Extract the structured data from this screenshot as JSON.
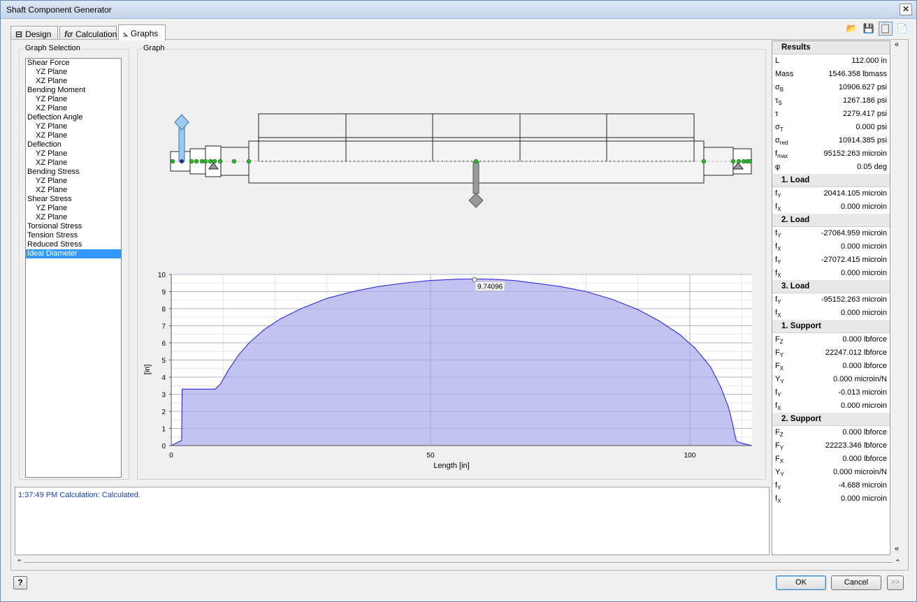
{
  "window": {
    "title": "Shaft Component Generator",
    "close_symbol": "✕"
  },
  "tabs": [
    {
      "label": "Design",
      "icon": "design-icon"
    },
    {
      "label": "Calculation",
      "icon": "calculation-icon"
    },
    {
      "label": "Graphs",
      "icon": "graph-icon"
    }
  ],
  "active_tab": "Graphs",
  "graph_selection": {
    "caption": "Graph Selection",
    "items": [
      {
        "label": "Shear Force",
        "level": 0
      },
      {
        "label": "YZ Plane",
        "level": 1
      },
      {
        "label": "XZ Plane",
        "level": 1
      },
      {
        "label": "Bending Moment",
        "level": 0
      },
      {
        "label": "YZ Plane",
        "level": 1
      },
      {
        "label": "XZ Plane",
        "level": 1
      },
      {
        "label": "Deflection Angle",
        "level": 0
      },
      {
        "label": "YZ Plane",
        "level": 1
      },
      {
        "label": "XZ Plane",
        "level": 1
      },
      {
        "label": "Deflection",
        "level": 0
      },
      {
        "label": "YZ Plane",
        "level": 1
      },
      {
        "label": "XZ Plane",
        "level": 1
      },
      {
        "label": "Bending Stress",
        "level": 0
      },
      {
        "label": "YZ Plane",
        "level": 1
      },
      {
        "label": "XZ Plane",
        "level": 1
      },
      {
        "label": "Shear Stress",
        "level": 0
      },
      {
        "label": "YZ Plane",
        "level": 1
      },
      {
        "label": "XZ Plane",
        "level": 1
      },
      {
        "label": "Torsional Stress",
        "level": 0
      },
      {
        "label": "Tension Stress",
        "level": 0
      },
      {
        "label": "Reduced Stress",
        "level": 0
      },
      {
        "label": "Ideal Diameter",
        "level": 0,
        "selected": true
      }
    ]
  },
  "graph": {
    "caption": "Graph",
    "marker_label": "9.74096"
  },
  "chart_data": {
    "type": "area",
    "xlabel": "Length [in]",
    "ylabel": "[in]",
    "xlim": [
      0,
      112
    ],
    "ylim": [
      0,
      10
    ],
    "x_ticks": [
      "0",
      "50",
      "100"
    ],
    "y_ticks": [
      "0",
      "1",
      "2",
      "3",
      "4",
      "5",
      "6",
      "7",
      "8",
      "9",
      "10"
    ],
    "grid": true,
    "fill_color": "#c2c3f0",
    "line_color": "#2a2ae0",
    "series": [
      {
        "x": [
          0,
          2,
          2.1,
          8.5,
          9.5,
          11,
          13,
          15,
          18,
          21,
          25,
          30,
          35,
          40,
          45,
          50,
          55,
          58.5,
          62,
          66,
          70,
          75,
          80,
          85,
          90,
          94,
          98,
          101,
          104,
          106,
          107.5,
          108.3,
          108.7,
          109,
          110.5,
          112
        ],
        "y": [
          0,
          0.3,
          3.3,
          3.3,
          3.6,
          4.4,
          5.3,
          6.0,
          6.8,
          7.4,
          8.0,
          8.6,
          9.0,
          9.3,
          9.5,
          9.65,
          9.72,
          9.74,
          9.72,
          9.65,
          9.5,
          9.3,
          9.0,
          8.55,
          7.95,
          7.3,
          6.5,
          5.7,
          4.6,
          3.4,
          2.2,
          1.2,
          0.6,
          0.25,
          0.1,
          0
        ]
      }
    ],
    "annotations": [
      {
        "x": 58.5,
        "y": 9.74,
        "text": "9.74096"
      }
    ]
  },
  "log": {
    "message": "1:37:49 PM Calculation: Calculated."
  },
  "results": {
    "header": "Results",
    "rows": [
      {
        "k": "L",
        "sub": "",
        "v": "112.000 in"
      },
      {
        "k": "Mass",
        "sub": "",
        "v": "1546.358 lbmass"
      },
      {
        "k": "σ",
        "sub": "B",
        "v": "10906.627 psi"
      },
      {
        "k": "τ",
        "sub": "S",
        "v": "1267.186 psi"
      },
      {
        "k": "τ",
        "sub": "",
        "v": "2279.417 psi"
      },
      {
        "k": "σ",
        "sub": "T",
        "v": "0.000 psi"
      },
      {
        "k": "σ",
        "sub": "red",
        "v": "10914.385 psi"
      },
      {
        "k": "f",
        "sub": "max",
        "v": "95152.263 microin"
      },
      {
        "k": "φ",
        "sub": "",
        "v": "0.05 deg"
      },
      {
        "section": "1. Load"
      },
      {
        "k": "f",
        "sub": "Y",
        "v": "20414.105 microin"
      },
      {
        "k": "f",
        "sub": "X",
        "v": "0.000 microin"
      },
      {
        "section": "2. Load"
      },
      {
        "k": "f",
        "sub": "Y",
        "v": "-27064.959 microin"
      },
      {
        "k": "f",
        "sub": "X",
        "v": "0.000 microin"
      },
      {
        "k": "f",
        "sub": "Y",
        "v": "-27072.415 microin"
      },
      {
        "k": "f",
        "sub": "X",
        "v": "0.000 microin"
      },
      {
        "section": "3. Load"
      },
      {
        "k": "f",
        "sub": "Y",
        "v": "-95152.263 microin"
      },
      {
        "k": "f",
        "sub": "X",
        "v": "0.000 microin"
      },
      {
        "section": "1. Support"
      },
      {
        "k": "F",
        "sub": "Z",
        "v": "0.000 lbforce"
      },
      {
        "k": "F",
        "sub": "Y",
        "v": "22247.012 lbforce"
      },
      {
        "k": "F",
        "sub": "X",
        "v": "0.000 lbforce"
      },
      {
        "k": "Y",
        "sub": "Y",
        "v": "0.000 microin/N"
      },
      {
        "k": "f",
        "sub": "Y",
        "v": "-0.013 microin"
      },
      {
        "k": "f",
        "sub": "X",
        "v": "0.000 microin"
      },
      {
        "section": "2. Support"
      },
      {
        "k": "F",
        "sub": "Z",
        "v": "0.000 lbforce"
      },
      {
        "k": "F",
        "sub": "Y",
        "v": "22223.346 lbforce"
      },
      {
        "k": "F",
        "sub": "X",
        "v": "0.000 lbforce"
      },
      {
        "k": "Y",
        "sub": "Y",
        "v": "0.000 microin/N"
      },
      {
        "k": "f",
        "sub": "Y",
        "v": "-4.688 microin"
      },
      {
        "k": "f",
        "sub": "X",
        "v": "0.000 microin"
      }
    ]
  },
  "buttons": {
    "ok": "OK",
    "cancel": "Cancel",
    "more": ">>",
    "help": "?"
  },
  "toolbar": [
    {
      "icon": "open-folder-icon",
      "glyph": "📂"
    },
    {
      "icon": "save-icon",
      "glyph": "💾"
    },
    {
      "icon": "calc-report-icon",
      "glyph": "📋"
    },
    {
      "icon": "notes-icon",
      "glyph": "📄"
    }
  ],
  "scroll_arrows": {
    "up": "«",
    "down": "«",
    "expand": "⌃"
  }
}
